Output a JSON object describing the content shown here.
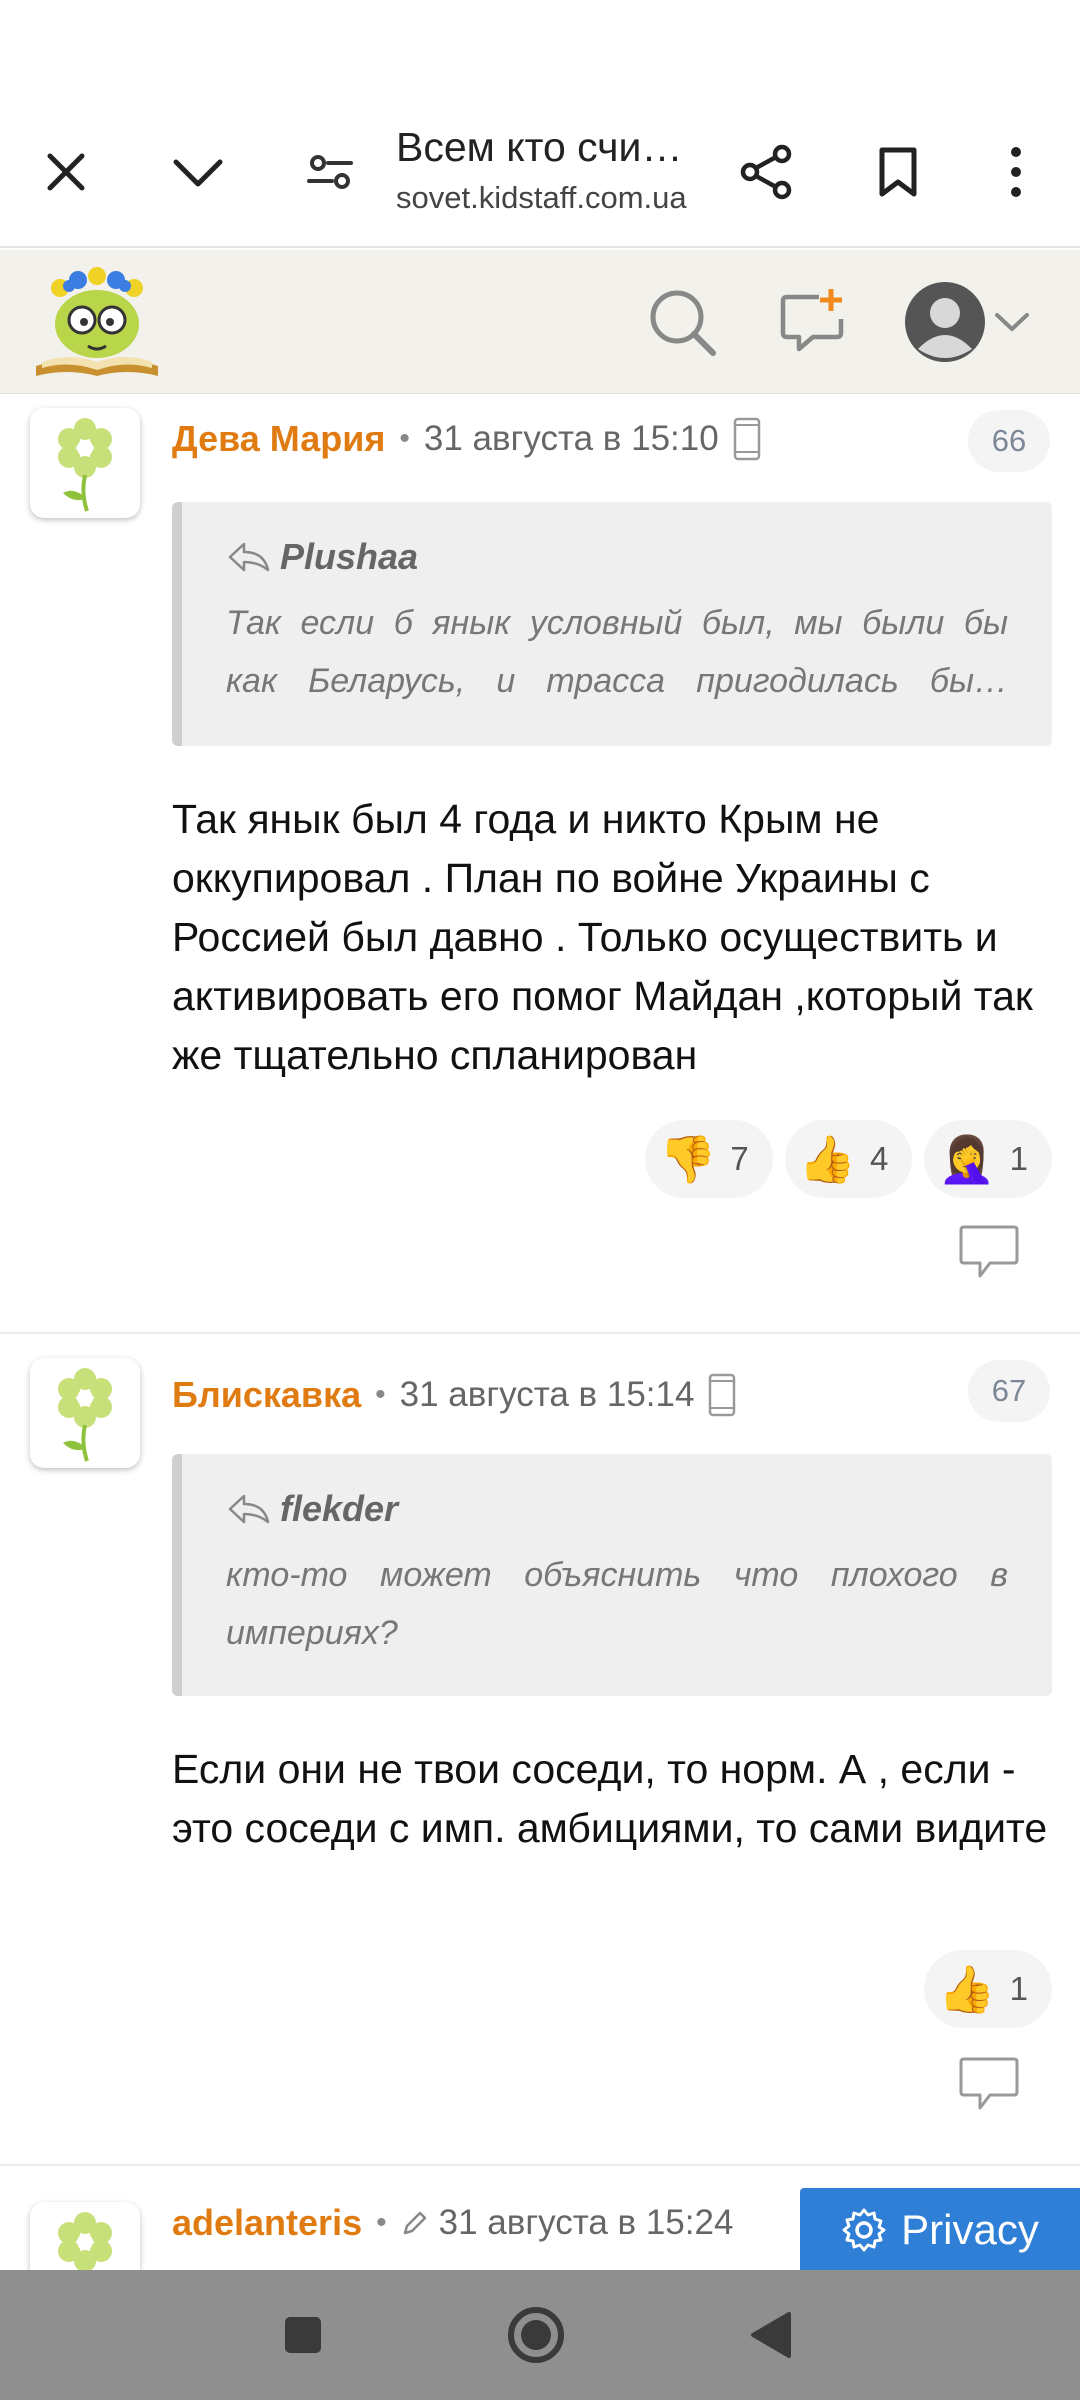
{
  "toolbar": {
    "title": "Всем кто счи…",
    "url": "sovet.kidstaff.com.ua",
    "icons": [
      "close-icon",
      "chevron-down-icon",
      "page-settings-icon",
      "share-icon",
      "bookmark-icon",
      "more-vert-icon"
    ]
  },
  "site_header": {
    "icons": [
      "search-icon",
      "new-message-icon",
      "user-avatar-icon",
      "chevron-down-icon"
    ]
  },
  "posts": [
    {
      "author": "Дева Мария",
      "date": "31 августа в 15:10",
      "number": "66",
      "quote_author": "Plushaa",
      "quote_line1": "Так если б янык условный был, мы были бы",
      "quote_line2": "как Беларусь, и трасса пригодилась бы…",
      "text": "Так янык был 4 года и никто Крым не оккупировал . План по войне Украины с Россией был давно . Только осуществить и активировать его помог Майдан ,который так же тщательно спланирован",
      "reactions": [
        {
          "emoji": "👎",
          "count": "7"
        },
        {
          "emoji": "👍",
          "count": "4"
        },
        {
          "emoji": "🤦‍♀️",
          "count": "1"
        }
      ]
    },
    {
      "author": "Блискавка",
      "date": "31 августа в 15:14",
      "number": "67",
      "quote_author": "flekder",
      "quote_line1": "кто-то может объяснить что плохого в",
      "quote_line2": "империях?",
      "text": "Если они не твои соседи, то норм. А , если - это соседи с имп. амбициями, то сами видите",
      "reactions": [
        {
          "emoji": "👍",
          "count": "1"
        }
      ]
    },
    {
      "author": "adelanteris",
      "date": "31 августа в 15:24"
    }
  ],
  "privacy_label": "Privacy",
  "colors": {
    "author": "#e07b12",
    "privacy": "#2f7fd6",
    "navbar": "#8f8f8f"
  }
}
